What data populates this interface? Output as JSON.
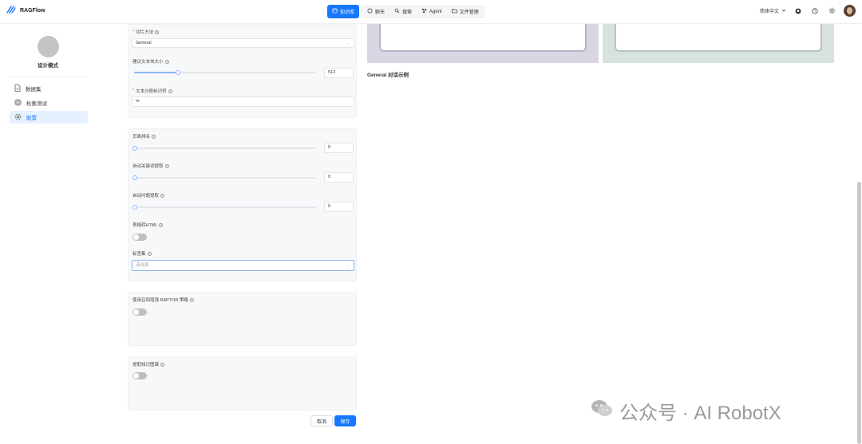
{
  "app": {
    "name": "RAGFlow"
  },
  "nav": {
    "items": [
      {
        "label": "知识库",
        "icon": "database-icon",
        "active": true
      },
      {
        "label": "聊天",
        "icon": "chat-icon",
        "active": false
      },
      {
        "label": "搜索",
        "icon": "search-icon",
        "active": false
      },
      {
        "label": "Agent",
        "icon": "agent-icon",
        "active": false
      },
      {
        "label": "文件管理",
        "icon": "folder-icon",
        "active": false
      }
    ]
  },
  "top_right": {
    "language": "简体中文"
  },
  "sidebar": {
    "kb_name": "设计模式",
    "items": [
      {
        "label": "数据集",
        "icon": "file-icon",
        "active": false
      },
      {
        "label": "检索测试",
        "icon": "target-icon",
        "active": false
      },
      {
        "label": "配置",
        "icon": "gear-icon",
        "active": true
      }
    ]
  },
  "form": {
    "chunk_method": {
      "label": "切片方法",
      "value": "General"
    },
    "chunk_size": {
      "label": "建议文本块大小",
      "value": "512"
    },
    "delimiter": {
      "label": "文本分段标识符",
      "value": "\\n"
    },
    "page_rank": {
      "label": "页面排名",
      "value": "0"
    },
    "auto_keywords": {
      "label": "自动关键词提取",
      "value": "0"
    },
    "auto_questions": {
      "label": "自动问题提取",
      "value": "0"
    },
    "html4excel": {
      "label": "表格转HTML"
    },
    "tag_sets": {
      "label": "标签集",
      "placeholder": "请选择"
    },
    "raptor": {
      "label": "使用召回增强 RAPTOR 策略"
    },
    "graphrag": {
      "label": "提取知识图谱"
    },
    "cancel_label": "取消",
    "save_label": "保存"
  },
  "preview": {
    "caption": "General 对话示例"
  },
  "watermark": {
    "text": "公众号 · AI RobotX"
  },
  "colors": {
    "accent": "#1677ff",
    "preview_left": "#d9d6e3",
    "preview_right": "#d8e2dc"
  }
}
